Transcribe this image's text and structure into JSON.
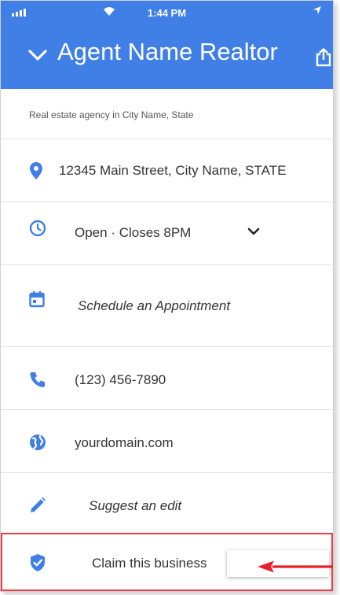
{
  "status_bar": {
    "time": "1:44 PM"
  },
  "header": {
    "title": "Agent Name Realtor"
  },
  "listing": {
    "category": "Real estate agency in City Name, State",
    "address": "12345 Main Street, City Name, STATE",
    "hours": "Open · Closes 8PM",
    "appointment": "Schedule an Appointment",
    "phone": "(123) 456-7890",
    "website": "yourdomain.com",
    "suggest_edit": "Suggest an edit",
    "claim": "Claim this business"
  },
  "colors": {
    "header_bg": "#3f7fe6",
    "icon": "#3f7fe6",
    "highlight": "#e8404a"
  },
  "icons": [
    "chevron-down-icon",
    "share-icon",
    "location-pin-icon",
    "clock-icon",
    "calendar-icon",
    "phone-icon",
    "globe-icon",
    "pencil-icon",
    "shield-check-icon",
    "arrow-left-icon"
  ]
}
